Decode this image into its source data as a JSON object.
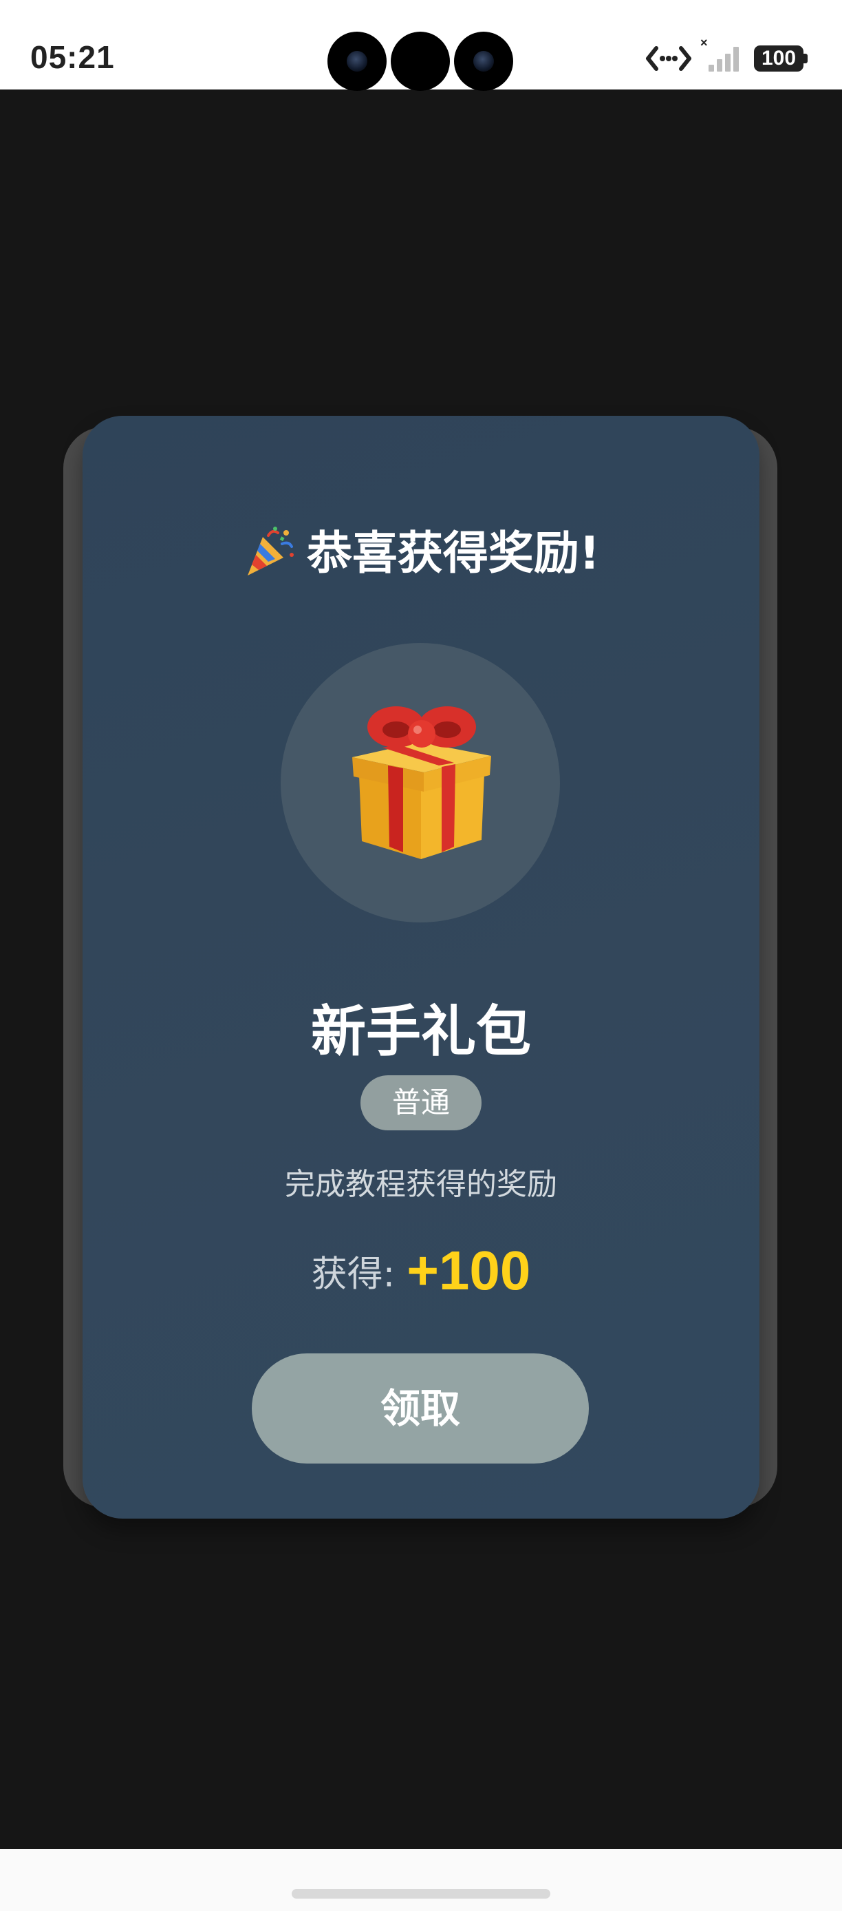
{
  "status_bar": {
    "time": "05:21",
    "battery": "100",
    "icons": [
      "network-transfer-icon",
      "signal-no-service-icon",
      "battery-icon"
    ]
  },
  "modal": {
    "title": "恭喜获得奖励!",
    "title_icon": "party-popper-icon",
    "item_icon": "gift-box-icon",
    "item_name": "新手礼包",
    "rarity": "普通",
    "description": "完成教程获得的奖励",
    "reward_label": "获得:",
    "reward_amount": "+100",
    "claim_label": "领取"
  },
  "colors": {
    "backdrop": "#161616",
    "modal_bg": "#33475b",
    "reward_amount": "#ffd21a",
    "claim_button": "#94a4a4",
    "rarity_badge": "#929f9f"
  }
}
